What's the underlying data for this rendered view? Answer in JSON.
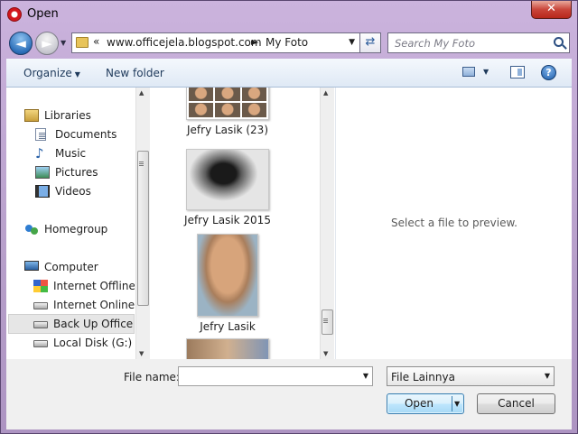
{
  "window": {
    "title": "Open",
    "close_label": "✕"
  },
  "navigation": {
    "back_label": "◄",
    "forward_label": "►",
    "history_label": "▼",
    "address_chevron": "«",
    "address_segments": [
      "www.officejela.blogspot.com",
      "My Foto"
    ],
    "address_separator": "►",
    "refresh_label": "⇄",
    "search_placeholder": "Search My Foto"
  },
  "toolbar": {
    "organize_label": "Organize",
    "organize_arrow": "▼",
    "new_folder_label": "New folder",
    "view_arrow": "▼",
    "help_label": "?"
  },
  "sidebar": {
    "items": [
      {
        "label": "Libraries",
        "icon": "library-icon"
      },
      {
        "label": "Documents",
        "icon": "documents-icon"
      },
      {
        "label": "Music",
        "icon": "music-icon",
        "glyph": "♪"
      },
      {
        "label": "Pictures",
        "icon": "pictures-icon"
      },
      {
        "label": "Videos",
        "icon": "videos-icon"
      },
      {
        "label": "Homegroup",
        "icon": "homegroup-icon"
      },
      {
        "label": "Computer",
        "icon": "computer-icon"
      },
      {
        "label": "Internet Offline (",
        "icon": "windows-drive-icon"
      },
      {
        "label": "Internet Online (I",
        "icon": "drive-icon"
      },
      {
        "label": "Back Up Office Je",
        "icon": "drive-icon",
        "selected": true
      },
      {
        "label": "Local Disk (G:)",
        "icon": "drive-icon"
      }
    ],
    "scroll_up": "▲",
    "scroll_down": "▼"
  },
  "files": {
    "items": [
      {
        "name": "Jefry Lasik (23)",
        "thumb": "collage"
      },
      {
        "name": "Jefry Lasik 2015",
        "thumb": "black-white-photo"
      },
      {
        "name": "Jefry Lasik",
        "thumb": "portrait-photo"
      },
      {
        "name": "",
        "thumb": "partial-photo"
      }
    ],
    "scroll_up": "▲",
    "scroll_down": "▼"
  },
  "preview": {
    "message": "Select a file to preview."
  },
  "footer": {
    "file_name_label": "File name:",
    "file_name_value": "",
    "file_name_arrow": "▼",
    "file_type_value": "File Lainnya",
    "file_type_arrow": "▼",
    "open_label": "Open",
    "open_arrow": "▼",
    "cancel_label": "Cancel"
  }
}
